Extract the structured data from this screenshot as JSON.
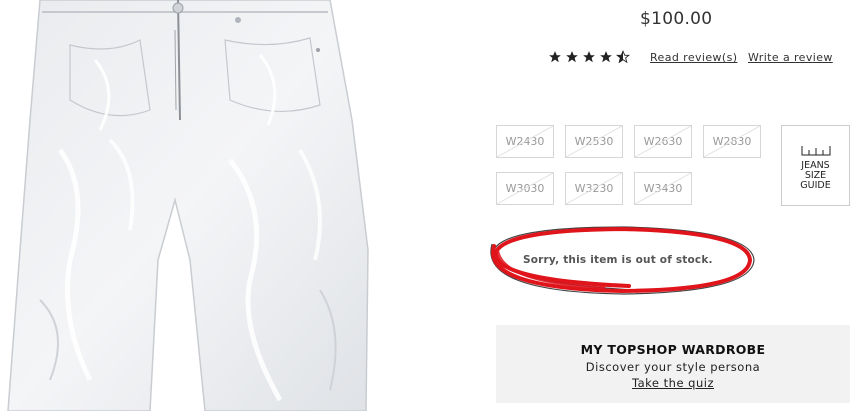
{
  "product": {
    "price": "$100.00",
    "rating_value": 4.5,
    "rating_max": 5,
    "read_reviews_label": "Read review(s)",
    "write_review_label": "Write a review"
  },
  "sizes": [
    {
      "label": "W2430",
      "available": false
    },
    {
      "label": "W2530",
      "available": false
    },
    {
      "label": "W2630",
      "available": false
    },
    {
      "label": "W2830",
      "available": false
    },
    {
      "label": "W3030",
      "available": false
    },
    {
      "label": "W3230",
      "available": false
    },
    {
      "label": "W3430",
      "available": false
    }
  ],
  "size_guide": {
    "line1": "JEANS",
    "line2": "SIZE",
    "line3": "GUIDE",
    "icon": "ruler-icon"
  },
  "stock": {
    "message": "Sorry, this item is out of stock.",
    "annotation_color": "#e0141b"
  },
  "wardrobe": {
    "title": "MY TOPSHOP WARDROBE",
    "subtitle": "Discover your style persona",
    "link": "Take the quiz"
  }
}
